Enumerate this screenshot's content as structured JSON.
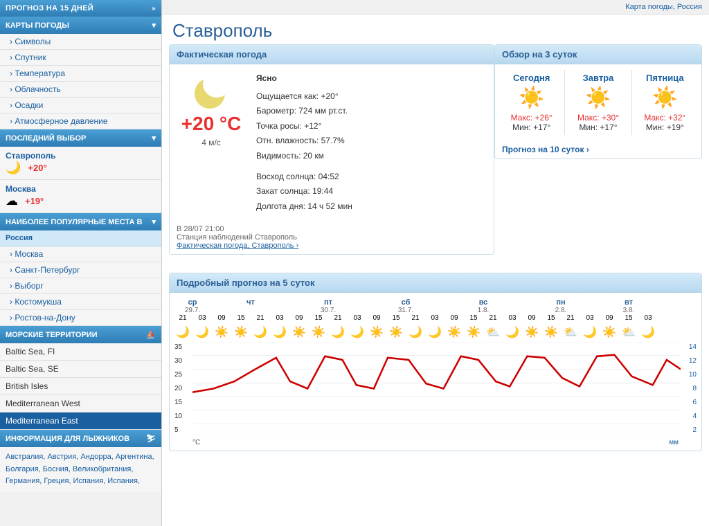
{
  "sidebar": {
    "forecast_header": "ПРОГНОЗ НА 15 ДНЕЙ",
    "maps_header": "КАРТЫ ПОГОДЫ",
    "maps_items": [
      "Символы",
      "Спутник",
      "Температура",
      "Облачность",
      "Осадки",
      "Атмосферное давление"
    ],
    "last_choice_header": "ПОСЛЕДНИЙ ВЫБОР",
    "last_choice_items": [
      {
        "city": "Ставрополь",
        "temp": "+20°",
        "icon": "🌙"
      },
      {
        "city": "Москва",
        "temp": "+19°",
        "icon": "☁"
      }
    ],
    "popular_header": "НАИБОЛЕЕ ПОПУЛЯРНЫЕ МЕСТА В",
    "popular_section": "Россия",
    "popular_items": [
      "Москва",
      "Санкт-Петербург",
      "Выборг",
      "Костомукша",
      "Ростов-на-Дону"
    ],
    "maritime_header": "МОРСКИЕ ТЕРРИТОРИИ",
    "maritime_items": [
      "Baltic Sea, FI",
      "Baltic Sea, SE",
      "British Isles",
      "Mediterranean West",
      "Mediterranean East"
    ],
    "maritime_active": "Mediterranean East",
    "ski_header": "ИНФОРМАЦИЯ ДЛЯ ЛЫЖНИКОВ",
    "ski_content": "Австралия, Австрия, Андорра,\nАргентина, Болгария, Босния,\nВеликобритания, Германия,\nГреция, Испания, Испания,"
  },
  "topbar": {
    "link": "Карта погоды, Россия"
  },
  "city": {
    "name": "Ставрополь"
  },
  "current": {
    "header": "Фактическая погода",
    "temp": "+20 °C",
    "wind": "4 м/с",
    "condition": "Ясно",
    "feels_like": "Ощущается как: +20°",
    "pressure": "Барометр: 724 мм рт.ст.",
    "dew_point": "Точка росы: +12°",
    "humidity": "Отн. влажность: 57.7%",
    "visibility": "Видимость: 20 км",
    "sunrise": "Восход солнца: 04:52",
    "sunset": "Закат солнца: 19:44",
    "day_length": "Долгота дня: 14 ч 52 мин",
    "obs_time": "В 28/07 21:00",
    "obs_station": "Станция наблюдений Ставрополь",
    "obs_link": "Фактическая погода, Ставрополь ›"
  },
  "forecast3": {
    "header": "Обзор на 3 суток",
    "days": [
      {
        "name": "Сегодня",
        "icon": "☀",
        "max": "Макс: +26°",
        "min": "Мин: +17°"
      },
      {
        "name": "Завтра",
        "icon": "☀",
        "max": "Макс: +30°",
        "min": "Мин: +17°"
      },
      {
        "name": "Пятница",
        "icon": "☀",
        "max": "Макс: +32°",
        "min": "Мин: +19°"
      }
    ],
    "link": "Прогноз на 10 суток ›"
  },
  "forecast5": {
    "header": "Подробный прогноз на 5 суток",
    "days": [
      {
        "label": "ср",
        "date": "29.7.",
        "hours": [
          "21",
          "03"
        ]
      },
      {
        "label": "чт",
        "date": "",
        "hours": [
          "09",
          "15",
          "21",
          "03"
        ]
      },
      {
        "label": "пт",
        "date": "30.7.",
        "hours": [
          "09",
          "15",
          "21",
          "03"
        ]
      },
      {
        "label": "сб",
        "date": "31.7.",
        "hours": [
          "09",
          "15",
          "21",
          "03"
        ]
      },
      {
        "label": "вс",
        "date": "1.8.",
        "hours": [
          "09",
          "15",
          "21",
          "03"
        ]
      },
      {
        "label": "пн",
        "date": "2.8.",
        "hours": [
          "09",
          "15",
          "21",
          "03"
        ]
      },
      {
        "label": "вт",
        "date": "3.8.",
        "hours": [
          "09",
          "15",
          "03"
        ]
      }
    ],
    "chart_y_left": [
      "35",
      "30",
      "25",
      "20",
      "15",
      "10",
      "5",
      "°C"
    ],
    "chart_y_right": [
      "14",
      "12",
      "10",
      "8",
      "6",
      "4",
      "2",
      "мм"
    ]
  }
}
